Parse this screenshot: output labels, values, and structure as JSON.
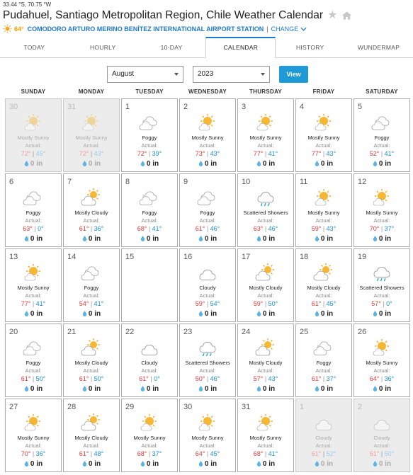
{
  "header": {
    "coords": "33.44 °S, 70.75 °W",
    "title": "Pudahuel, Santiago Metropolitan Region, Chile Weather Calendar",
    "current_temp": "64°",
    "station": "COMODORO ARTURO MERINO BENÍTEZ INTERNATIONAL AIRPORT STATION",
    "separator": "|",
    "change_label": "CHANGE"
  },
  "tabs": [
    {
      "label": "TODAY"
    },
    {
      "label": "HOURLY"
    },
    {
      "label": "10-DAY"
    },
    {
      "label": "CALENDAR",
      "active": true
    },
    {
      "label": "HISTORY"
    },
    {
      "label": "WUNDERMAP"
    }
  ],
  "controls": {
    "month": "August",
    "year": "2023",
    "view_label": "View"
  },
  "weekdays": [
    "SUNDAY",
    "MONDAY",
    "TUESDAY",
    "WEDNESDAY",
    "THURSDAY",
    "FRIDAY",
    "SATURDAY"
  ],
  "actual_label": "Actual:",
  "precip_unit": "in",
  "colors": {
    "accent": "#1f78c8",
    "high": "#e03b3b",
    "low": "#1f8fd0",
    "button": "#1e9ad6"
  },
  "days": [
    {
      "day": "30",
      "other": true,
      "icon": "sunny-cloud",
      "cond": "Mostly Sunny",
      "hi": "72°",
      "lo": "45°",
      "precip": "0"
    },
    {
      "day": "31",
      "other": true,
      "icon": "sunny-cloud",
      "cond": "Mostly Sunny",
      "hi": "72°",
      "lo": "43°",
      "precip": "0"
    },
    {
      "day": "1",
      "icon": "fog",
      "cond": "Foggy",
      "hi": "72°",
      "lo": "39°",
      "precip": "0"
    },
    {
      "day": "2",
      "icon": "sunny-cloud",
      "cond": "Mostly Sunny",
      "hi": "73°",
      "lo": "43°",
      "precip": "0"
    },
    {
      "day": "3",
      "icon": "sunny-cloud",
      "cond": "Mostly Sunny",
      "hi": "77°",
      "lo": "41°",
      "precip": "0"
    },
    {
      "day": "4",
      "icon": "sunny-cloud",
      "cond": "Mostly Sunny",
      "hi": "77°",
      "lo": "43°",
      "precip": "0"
    },
    {
      "day": "5",
      "icon": "fog",
      "cond": "Foggy",
      "hi": "52°",
      "lo": "41°",
      "precip": "0"
    },
    {
      "day": "6",
      "icon": "fog",
      "cond": "Foggy",
      "hi": "63°",
      "lo": "0°",
      "precip": "0"
    },
    {
      "day": "7",
      "icon": "cloudy-sun",
      "cond": "Mostly Cloudy",
      "hi": "61°",
      "lo": "36°",
      "precip": "0"
    },
    {
      "day": "8",
      "icon": "fog",
      "cond": "Foggy",
      "hi": "68°",
      "lo": "41°",
      "precip": "0"
    },
    {
      "day": "9",
      "icon": "fog",
      "cond": "Foggy",
      "hi": "61°",
      "lo": "46°",
      "precip": "0"
    },
    {
      "day": "10",
      "icon": "showers",
      "cond": "Scattered Showers",
      "hi": "63°",
      "lo": "46°",
      "precip": "0"
    },
    {
      "day": "11",
      "icon": "sunny-cloud",
      "cond": "Mostly Sunny",
      "hi": "59°",
      "lo": "43°",
      "precip": "0"
    },
    {
      "day": "12",
      "icon": "sunny-cloud",
      "cond": "Mostly Sunny",
      "hi": "70°",
      "lo": "37°",
      "precip": "0"
    },
    {
      "day": "13",
      "icon": "sunny-cloud",
      "cond": "Mostly Sunny",
      "hi": "77°",
      "lo": "41°",
      "precip": "0"
    },
    {
      "day": "14",
      "icon": "fog",
      "cond": "Foggy",
      "hi": "54°",
      "lo": "41°",
      "precip": "0"
    },
    {
      "day": "15",
      "icon": "none",
      "cond": "",
      "hi": "",
      "lo": "",
      "precip": "",
      "empty": true
    },
    {
      "day": "16",
      "icon": "cloud",
      "cond": "Cloudy",
      "hi": "59°",
      "lo": "54°",
      "precip": "0"
    },
    {
      "day": "17",
      "icon": "cloudy-sun",
      "cond": "Mostly Cloudy",
      "hi": "59°",
      "lo": "50°",
      "precip": "0"
    },
    {
      "day": "18",
      "icon": "cloudy-sun",
      "cond": "Mostly Cloudy",
      "hi": "61°",
      "lo": "45°",
      "precip": "0"
    },
    {
      "day": "19",
      "icon": "showers",
      "cond": "Scattered Showers",
      "hi": "57°",
      "lo": "0°",
      "precip": "0"
    },
    {
      "day": "20",
      "icon": "fog",
      "cond": "Foggy",
      "hi": "61°",
      "lo": "50°",
      "precip": "0"
    },
    {
      "day": "21",
      "icon": "cloudy-sun",
      "cond": "Mostly Cloudy",
      "hi": "61°",
      "lo": "50°",
      "precip": "0"
    },
    {
      "day": "22",
      "icon": "cloud",
      "cond": "Cloudy",
      "hi": "61°",
      "lo": "0°",
      "precip": "0"
    },
    {
      "day": "23",
      "icon": "showers",
      "cond": "Scattered Showers",
      "hi": "50°",
      "lo": "46°",
      "precip": "0"
    },
    {
      "day": "24",
      "icon": "cloudy-sun",
      "cond": "Mostly Cloudy",
      "hi": "57°",
      "lo": "43°",
      "precip": "0"
    },
    {
      "day": "25",
      "icon": "fog",
      "cond": "Foggy",
      "hi": "61°",
      "lo": "37°",
      "precip": "0"
    },
    {
      "day": "26",
      "icon": "sunny-cloud",
      "cond": "Mostly Sunny",
      "hi": "64°",
      "lo": "36°",
      "precip": "0"
    },
    {
      "day": "27",
      "icon": "sunny-cloud",
      "cond": "Mostly Sunny",
      "hi": "70°",
      "lo": "36°",
      "precip": "0"
    },
    {
      "day": "28",
      "icon": "cloudy-sun",
      "cond": "Mostly Cloudy",
      "hi": "61°",
      "lo": "48°",
      "precip": "0"
    },
    {
      "day": "29",
      "icon": "sunny-cloud",
      "cond": "Mostly Sunny",
      "hi": "68°",
      "lo": "37°",
      "precip": "0"
    },
    {
      "day": "30",
      "icon": "sunny-cloud",
      "cond": "Mostly Sunny",
      "hi": "64°",
      "lo": "45°",
      "precip": "0"
    },
    {
      "day": "31",
      "icon": "sunny-cloud",
      "cond": "Mostly Sunny",
      "hi": "68°",
      "lo": "41°",
      "precip": "0"
    },
    {
      "day": "1",
      "other": true,
      "icon": "cloud",
      "cond": "Cloudy",
      "hi": "61°",
      "lo": "52°",
      "precip": "0"
    },
    {
      "day": "2",
      "other": true,
      "icon": "cloud",
      "cond": "Cloudy",
      "hi": "61°",
      "lo": "50°",
      "precip": "0"
    }
  ]
}
